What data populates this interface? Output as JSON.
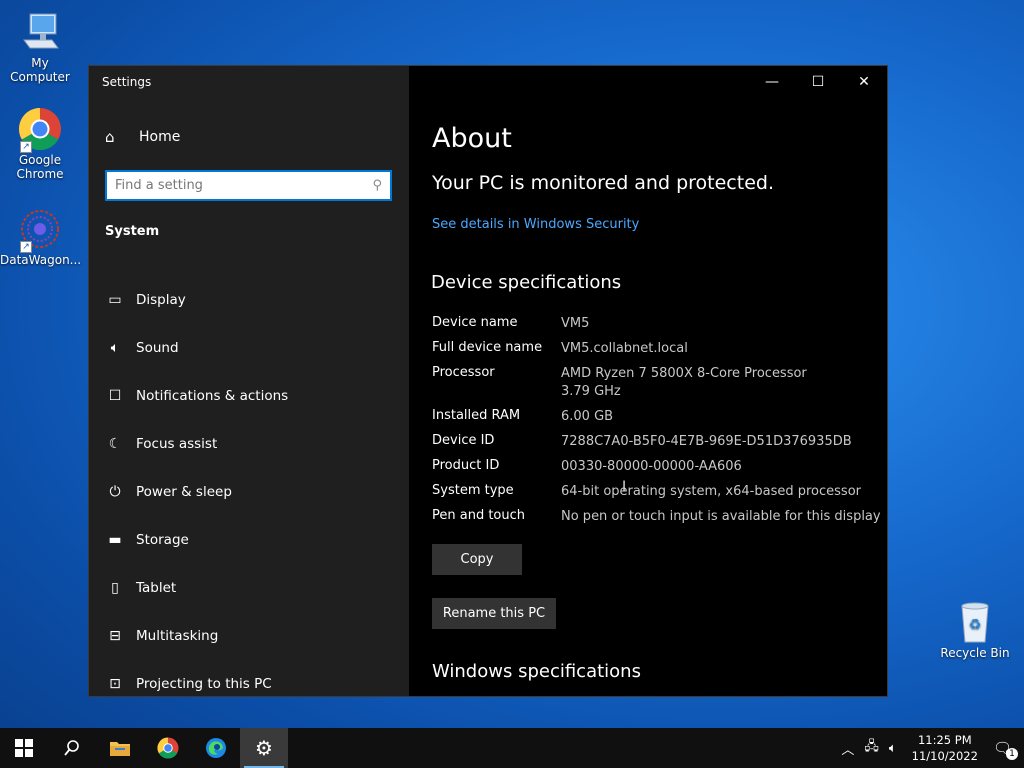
{
  "desktop": {
    "icons": [
      {
        "label": "My Computer"
      },
      {
        "label": "Google Chrome"
      },
      {
        "label": "DataWagon..."
      },
      {
        "label": "Recycle Bin"
      }
    ]
  },
  "window": {
    "title": "Settings",
    "sidebar": {
      "home_label": "Home",
      "search_placeholder": "Find a setting",
      "section_label": "System",
      "items": [
        {
          "label": "Display",
          "icon": "monitor-icon"
        },
        {
          "label": "Sound",
          "icon": "speaker-icon"
        },
        {
          "label": "Notifications & actions",
          "icon": "notification-icon"
        },
        {
          "label": "Focus assist",
          "icon": "moon-icon"
        },
        {
          "label": "Power & sleep",
          "icon": "power-icon"
        },
        {
          "label": "Storage",
          "icon": "storage-icon"
        },
        {
          "label": "Tablet",
          "icon": "tablet-icon"
        },
        {
          "label": "Multitasking",
          "icon": "multitasking-icon"
        },
        {
          "label": "Projecting to this PC",
          "icon": "projector-icon"
        }
      ]
    },
    "content": {
      "heading": "About",
      "protection_text": "Your PC is monitored and protected.",
      "security_link": "See details in Windows Security",
      "device_specs_heading": "Device specifications",
      "specs": [
        {
          "key": "Device name",
          "value": "VM5"
        },
        {
          "key": "Full device name",
          "value": "VM5.collabnet.local"
        },
        {
          "key": "Processor",
          "value": "AMD Ryzen 7 5800X 8-Core Processor",
          "value2": "3.79 GHz"
        },
        {
          "key": "Installed RAM",
          "value": "6.00 GB"
        },
        {
          "key": "Device ID",
          "value": "7288C7A0-B5F0-4E7B-969E-D51D376935DB"
        },
        {
          "key": "Product ID",
          "value": "00330-80000-00000-AA606"
        },
        {
          "key": "System type",
          "value": "64-bit operating system, x64-based processor"
        },
        {
          "key": "Pen and touch",
          "value": "No pen or touch input is available for this display"
        }
      ],
      "copy_label": "Copy",
      "rename_label": "Rename this PC",
      "windows_specs_heading": "Windows specifications"
    }
  },
  "taskbar": {
    "time": "11:25 PM",
    "date": "11/10/2022",
    "notification_count": "1"
  },
  "colors": {
    "accent": "#0078d7",
    "link": "#4aa8ff",
    "sidebar_bg": "#1f1f1f",
    "content_bg": "#000000"
  }
}
